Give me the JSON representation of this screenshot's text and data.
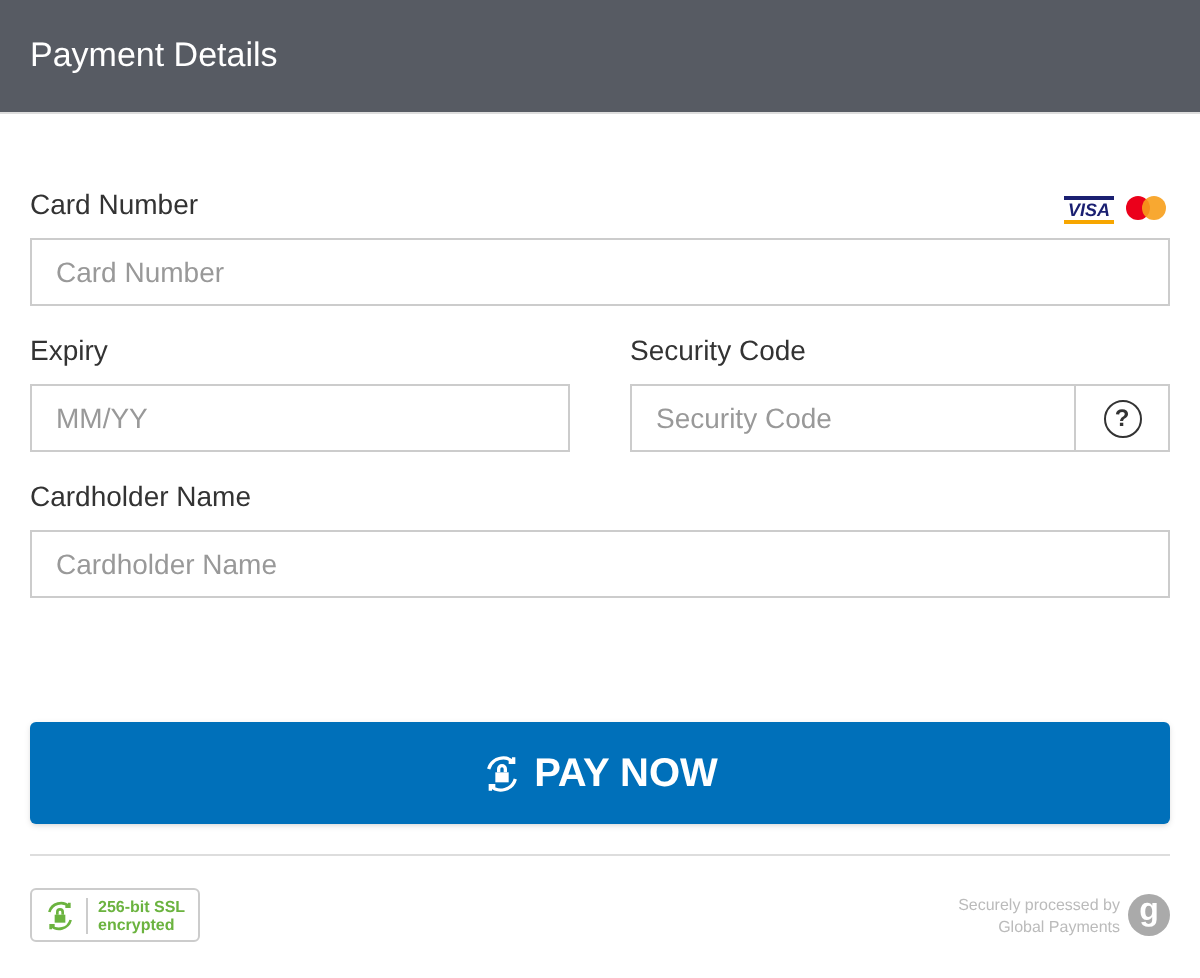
{
  "header": {
    "title": "Payment Details"
  },
  "card_number": {
    "label": "Card Number",
    "placeholder": "Card Number",
    "brands": [
      {
        "kind": "visa",
        "text": "VISA"
      },
      {
        "kind": "mastercard"
      }
    ]
  },
  "expiry": {
    "label": "Expiry",
    "placeholder": "MM/YY"
  },
  "security_code": {
    "label": "Security Code",
    "placeholder": "Security Code",
    "help": "?"
  },
  "cardholder": {
    "label": "Cardholder Name",
    "placeholder": "Cardholder Name"
  },
  "pay_button": {
    "label": "PAY NOW"
  },
  "ssl_badge": {
    "line1": "256-bit SSL",
    "line2": "encrypted"
  },
  "processor": {
    "line1": "Securely processed by",
    "line2": "Global Payments",
    "logo": "g"
  }
}
